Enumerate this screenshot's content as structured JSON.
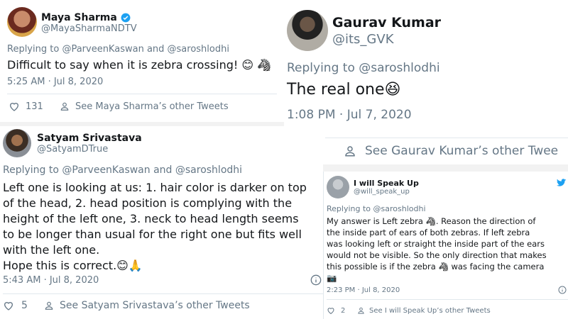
{
  "tweets": {
    "maya": {
      "name": "Maya Sharma",
      "handle": "@MayaSharmaNDTV",
      "reply_prefix": "Replying to ",
      "reply_to": "@ParveenKaswan and @saroshlodhi",
      "text": "Difficult to say when it is zebra crossing! 😊 🦓",
      "time": "5:25 AM · Jul 8, 2020",
      "likes": "131",
      "other_tweets": "See Maya Sharma’s other Tweets"
    },
    "gaurav": {
      "name": "Gaurav Kumar",
      "handle": "@its_GVK",
      "reply_prefix": "Replying to ",
      "reply_to": "@saroshlodhi",
      "text": "The real one😆",
      "time": "1:08 PM · Jul 7, 2020",
      "other_tweets": "See Gaurav Kumar’s other Twee"
    },
    "satyam": {
      "name": "Satyam Srivastava",
      "handle": "@SatyamDTrue",
      "reply_prefix": "Replying to ",
      "reply_to": "@ParveenKaswan and @saroshlodhi",
      "line1": "Left one is looking at us: 1. hair color is darker on top",
      "line2": "of the head, 2. head position is complying with the",
      "line3": "height of the left one, 3. neck to head length seems",
      "line4": "to be longer than usual for the right one but fits well",
      "line5": "with the left one.",
      "line6": "Hope this is correct.😊🙏",
      "time": "5:43 AM · Jul 8, 2020",
      "likes": "5",
      "other_tweets": "See Satyam Srivastava’s other Tweets"
    },
    "speakup": {
      "name": "I will Speak Up",
      "handle": "@will_speak_up",
      "reply_prefix": "Replying to ",
      "reply_to": "@saroshlodhi",
      "line1": "My answer is Left zebra 🦓. Reason the direction of",
      "line2": "the inside part of ears of both zebras. If left zebra",
      "line3": "was looking left or straight the inside part of the ears",
      "line4": "would not be visible. So the only direction that makes",
      "line5": "this possible is if the zebra 🦓 was facing the camera",
      "line6": "📷",
      "time": "2:23 PM · Jul 8, 2020",
      "likes": "2",
      "other_tweets": "See I will Speak Up’s other Tweets"
    }
  },
  "icons": {
    "verified": "verified-badge-icon",
    "like": "heart-icon",
    "profile": "person-icon",
    "info": "info-icon",
    "twitter": "twitter-bird-icon"
  },
  "colors": {
    "twitter_blue": "#1da1f2",
    "muted": "#657786",
    "text": "#14171a"
  }
}
